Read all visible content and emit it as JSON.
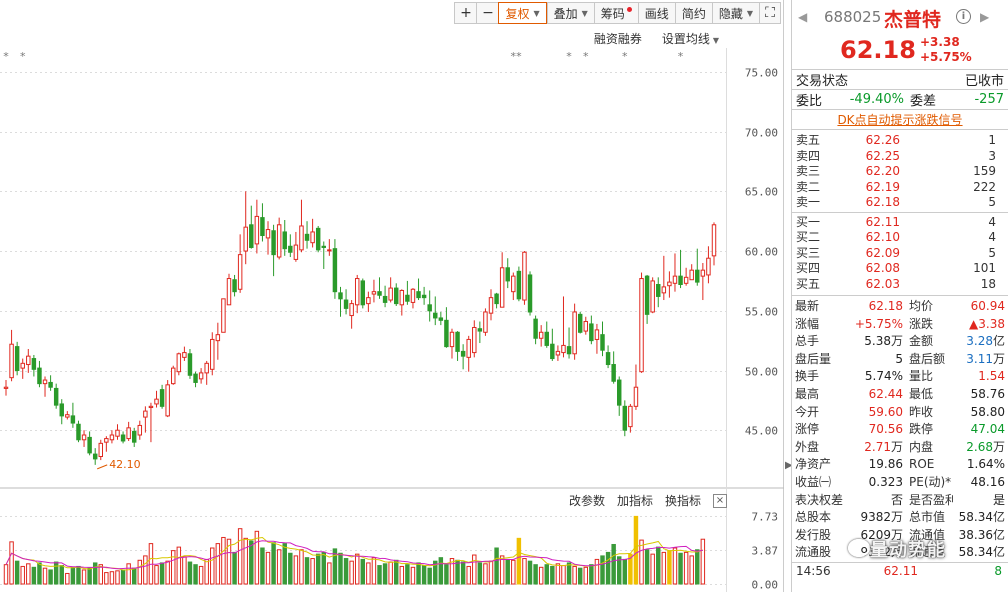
{
  "toolbar": {
    "plus": "+",
    "minus": "−",
    "fuquan": "复权",
    "diejia": "叠加",
    "chouma": "筹码",
    "huaxian": "画线",
    "jianyue": "简约",
    "yincang": "隐藏",
    "expand": "⛶"
  },
  "sub_toolbar": {
    "margin": "融资融券",
    "ma_settings": "设置均线"
  },
  "vol_toolbar": {
    "change_params": "改参数",
    "add_indicator": "加指标",
    "switch_indicator": "换指标",
    "close": "×"
  },
  "chart_data": {
    "type": "candlestick",
    "price_axis_labels": [
      "75.00",
      "70.00",
      "65.00",
      "60.00",
      "55.00",
      "50.00",
      "45.00"
    ],
    "price_ticks": [
      75,
      70,
      65,
      60,
      55,
      50,
      45
    ],
    "price_range": [
      41,
      77
    ],
    "volume_axis_labels": [
      "7.73",
      "3.87",
      "0.00"
    ],
    "volume_ticks": [
      7.73,
      3.87,
      0
    ],
    "volume_max": 8.2,
    "low_annotation": "42.10",
    "low_annotation_value": 42.1,
    "low_index": 16,
    "colors": {
      "up": "#e0281f",
      "down": "#2a9a2a",
      "vol_up": "#e0281f",
      "vol_down": "#3a9a3a",
      "vol_highlight": "#f0c000",
      "ma1": "#d020c0",
      "ma2": "#d8c800"
    },
    "candles": [
      [
        48.5,
        49.2,
        47.9,
        48.6
      ],
      [
        49.4,
        53.4,
        49.1,
        52.2
      ],
      [
        52.0,
        52.4,
        49.6,
        50.0
      ],
      [
        50.2,
        51.0,
        49.3,
        50.6
      ],
      [
        50.5,
        51.8,
        49.8,
        51.2
      ],
      [
        51.0,
        51.3,
        49.5,
        50.1
      ],
      [
        50.2,
        50.8,
        48.6,
        48.9
      ],
      [
        48.9,
        49.5,
        47.8,
        49.2
      ],
      [
        49.0,
        49.6,
        48.3,
        48.6
      ],
      [
        48.5,
        48.9,
        46.8,
        47.1
      ],
      [
        47.2,
        47.6,
        45.5,
        46.2
      ],
      [
        46.1,
        46.6,
        45.9,
        46.3
      ],
      [
        46.2,
        47.3,
        45.2,
        45.6
      ],
      [
        45.5,
        45.8,
        44.0,
        44.2
      ],
      [
        44.2,
        45.0,
        43.6,
        44.6
      ],
      [
        44.4,
        44.9,
        42.9,
        43.1
      ],
      [
        43.0,
        43.5,
        42.1,
        42.6
      ],
      [
        42.8,
        44.2,
        42.5,
        43.9
      ],
      [
        44.0,
        44.5,
        43.2,
        44.3
      ],
      [
        44.2,
        45.0,
        43.9,
        44.6
      ],
      [
        44.5,
        45.5,
        44.2,
        45.0
      ],
      [
        44.6,
        44.9,
        43.9,
        44.1
      ],
      [
        44.3,
        45.7,
        44.1,
        45.2
      ],
      [
        44.9,
        45.2,
        43.6,
        44.0
      ],
      [
        44.6,
        45.8,
        44.2,
        45.4
      ],
      [
        46.1,
        47.0,
        44.8,
        46.6
      ],
      [
        46.9,
        47.3,
        44.0,
        47.0
      ],
      [
        47.2,
        48.3,
        46.9,
        47.6
      ],
      [
        48.4,
        48.8,
        46.8,
        47.0
      ],
      [
        46.2,
        49.2,
        46.1,
        48.8
      ],
      [
        48.9,
        50.4,
        48.8,
        50.2
      ],
      [
        49.9,
        51.5,
        49.6,
        51.4
      ],
      [
        51.1,
        52.0,
        50.8,
        51.5
      ],
      [
        51.4,
        51.8,
        49.3,
        49.6
      ],
      [
        49.7,
        49.9,
        48.6,
        49.0
      ],
      [
        49.3,
        50.2,
        48.9,
        49.8
      ],
      [
        49.8,
        50.8,
        48.8,
        50.6
      ],
      [
        50.1,
        53.2,
        49.6,
        52.6
      ],
      [
        52.5,
        54.0,
        50.9,
        53.0
      ],
      [
        53.2,
        56.0,
        53.2,
        56.0
      ],
      [
        55.5,
        58.1,
        55.5,
        57.7
      ],
      [
        57.6,
        58.0,
        56.2,
        56.6
      ],
      [
        56.8,
        61.4,
        56.5,
        59.7
      ],
      [
        60.0,
        65.0,
        58.9,
        62.0
      ],
      [
        62.2,
        63.8,
        60.2,
        60.3
      ],
      [
        60.6,
        64.3,
        59.8,
        62.9
      ],
      [
        62.8,
        64.0,
        60.8,
        61.3
      ],
      [
        61.1,
        62.5,
        59.7,
        61.8
      ],
      [
        61.7,
        62.2,
        57.9,
        59.7
      ],
      [
        59.5,
        62.8,
        59.3,
        62.2
      ],
      [
        61.6,
        62.6,
        59.6,
        60.2
      ],
      [
        60.4,
        61.4,
        59.5,
        59.9
      ],
      [
        59.3,
        61.6,
        59.1,
        60.5
      ],
      [
        60.1,
        64.3,
        59.9,
        62.1
      ],
      [
        61.4,
        62.5,
        60.2,
        60.9
      ],
      [
        60.7,
        62.7,
        60.3,
        61.6
      ],
      [
        61.9,
        62.1,
        59.9,
        60.1
      ],
      [
        60.4,
        60.8,
        58.5,
        60.3
      ],
      [
        60.1,
        61.0,
        59.6,
        60.1
      ],
      [
        60.2,
        61.0,
        56.0,
        56.6
      ],
      [
        56.5,
        57.0,
        54.5,
        56.0
      ],
      [
        55.9,
        56.8,
        54.7,
        55.2
      ],
      [
        54.6,
        55.9,
        53.5,
        55.6
      ],
      [
        55.5,
        58.0,
        54.8,
        57.7
      ],
      [
        57.5,
        57.7,
        55.2,
        55.5
      ],
      [
        55.6,
        56.6,
        54.9,
        56.1
      ],
      [
        56.4,
        57.6,
        55.7,
        56.6
      ],
      [
        56.6,
        57.8,
        56.0,
        56.3
      ],
      [
        56.2,
        57.1,
        55.3,
        55.7
      ],
      [
        55.9,
        57.8,
        55.7,
        56.9
      ],
      [
        56.9,
        57.3,
        55.4,
        55.6
      ],
      [
        55.5,
        56.8,
        54.6,
        56.7
      ],
      [
        56.3,
        57.5,
        55.5,
        55.8
      ],
      [
        55.7,
        56.9,
        55.2,
        56.8
      ],
      [
        56.6,
        57.7,
        55.9,
        56.1
      ],
      [
        56.3,
        57.0,
        55.5,
        56.1
      ],
      [
        55.5,
        56.7,
        54.1,
        55.0
      ],
      [
        54.8,
        56.2,
        53.8,
        54.4
      ],
      [
        54.4,
        54.9,
        53.8,
        54.2
      ],
      [
        54.2,
        55.3,
        51.9,
        52.0
      ],
      [
        52.0,
        53.5,
        51.0,
        53.2
      ],
      [
        53.2,
        53.3,
        50.8,
        51.6
      ],
      [
        51.6,
        52.2,
        50.1,
        51.2
      ],
      [
        51.1,
        52.9,
        49.9,
        52.6
      ],
      [
        51.5,
        54.2,
        51.1,
        53.6
      ],
      [
        53.5,
        54.1,
        52.3,
        53.3
      ],
      [
        53.2,
        55.2,
        52.9,
        54.9
      ],
      [
        54.8,
        56.8,
        54.2,
        56.1
      ],
      [
        56.4,
        56.5,
        55.2,
        55.6
      ],
      [
        55.3,
        59.9,
        55.3,
        58.6
      ],
      [
        58.6,
        59.4,
        56.9,
        57.5
      ],
      [
        56.6,
        58.2,
        55.9,
        57.9
      ],
      [
        58.3,
        58.7,
        55.8,
        56.0
      ],
      [
        55.9,
        60.0,
        55.5,
        59.9
      ],
      [
        58.0,
        58.3,
        54.6,
        54.9
      ],
      [
        54.3,
        54.6,
        52.2,
        52.7
      ],
      [
        52.7,
        53.8,
        52.0,
        53.2
      ],
      [
        53.2,
        54.1,
        51.9,
        52.1
      ],
      [
        52.2,
        53.5,
        50.8,
        51.0
      ],
      [
        51.3,
        52.1,
        50.8,
        51.6
      ],
      [
        51.5,
        56.2,
        51.1,
        52.1
      ],
      [
        52.0,
        53.6,
        51.0,
        51.4
      ],
      [
        51.4,
        55.6,
        50.9,
        54.9
      ],
      [
        54.7,
        54.9,
        53.1,
        53.2
      ],
      [
        53.3,
        54.5,
        53.0,
        54.1
      ],
      [
        53.9,
        54.6,
        52.2,
        52.5
      ],
      [
        52.6,
        53.9,
        51.4,
        53.4
      ],
      [
        53.0,
        54.1,
        51.2,
        51.7
      ],
      [
        51.5,
        52.1,
        50.2,
        50.5
      ],
      [
        50.5,
        51.6,
        48.9,
        49.1
      ],
      [
        49.2,
        49.5,
        46.2,
        47.1
      ],
      [
        47.0,
        47.5,
        44.5,
        45.0
      ],
      [
        45.3,
        47.2,
        44.8,
        47.0
      ],
      [
        47.0,
        50.5,
        46.7,
        48.6
      ],
      [
        49.9,
        58.2,
        49.8,
        57.7
      ],
      [
        57.9,
        58.0,
        53.9,
        54.7
      ],
      [
        54.9,
        57.8,
        54.8,
        57.5
      ],
      [
        57.2,
        57.8,
        55.3,
        56.2
      ],
      [
        56.5,
        59.6,
        55.9,
        57.0
      ],
      [
        57.1,
        58.3,
        56.1,
        57.4
      ],
      [
        57.3,
        59.8,
        56.6,
        57.9
      ],
      [
        57.9,
        60.1,
        56.9,
        57.2
      ],
      [
        57.3,
        58.6,
        57.1,
        57.8
      ],
      [
        57.6,
        58.9,
        57.6,
        58.4
      ],
      [
        58.4,
        60.2,
        57.1,
        57.4
      ],
      [
        57.9,
        59.0,
        55.9,
        58.4
      ],
      [
        58.0,
        60.4,
        57.3,
        59.4
      ],
      [
        59.6,
        62.4,
        58.8,
        62.2
      ]
    ],
    "volumes": [
      2.2,
      4.8,
      2.6,
      2.0,
      2.3,
      1.9,
      2.4,
      1.8,
      1.6,
      2.5,
      2.1,
      1.2,
      1.9,
      2.0,
      1.6,
      1.8,
      2.4,
      2.2,
      1.3,
      1.4,
      1.5,
      1.6,
      2.3,
      1.8,
      2.7,
      3.2,
      4.6,
      2.1,
      2.4,
      2.6,
      3.8,
      4.2,
      3.1,
      2.5,
      2.2,
      2.0,
      2.8,
      4.1,
      4.6,
      5.3,
      5.1,
      3.6,
      6.3,
      5.2,
      4.9,
      6.0,
      4.1,
      3.6,
      4.7,
      3.9,
      4.6,
      3.5,
      3.2,
      3.9,
      3.0,
      2.9,
      3.4,
      3.6,
      2.4,
      4.0,
      3.5,
      2.9,
      2.6,
      3.4,
      2.8,
      2.4,
      3.0,
      2.1,
      2.3,
      2.5,
      2.7,
      2.0,
      2.2,
      1.9,
      2.4,
      2.1,
      1.8,
      2.6,
      3.0,
      2.2,
      2.9,
      2.7,
      2.5,
      2.0,
      3.3,
      2.4,
      2.3,
      2.6,
      4.1,
      3.2,
      2.8,
      2.7,
      5.2,
      2.9,
      2.6,
      2.2,
      1.9,
      2.2,
      2.0,
      2.3,
      2.1,
      2.4,
      2.0,
      1.8,
      1.9,
      2.2,
      2.8,
      3.2,
      3.6,
      4.5,
      3.1,
      2.8,
      3.4,
      7.7,
      5.0,
      3.9,
      3.4,
      4.2,
      3.6,
      3.8,
      4.1,
      3.5,
      3.6,
      3.2,
      3.9,
      5.1
    ],
    "highlight_volume_idx": [
      92,
      113
    ],
    "annotation_marker": "*"
  },
  "quote": {
    "code": "688025",
    "name": "杰普特",
    "price": "62.18",
    "change": "+3.38",
    "change_pct": "+5.75%",
    "prev_icon": "◀",
    "next_icon": "▶",
    "info_icon": "i"
  },
  "status": {
    "label": "交易状态",
    "value": "已收市"
  },
  "weibi": {
    "label1": "委比",
    "value1": "-49.40%",
    "label2": "委差",
    "value2": "-257"
  },
  "dk_link": "DK点自动提示涨跌信号",
  "orderbook": {
    "asks": [
      {
        "label": "卖五",
        "price": "62.26",
        "vol": "1"
      },
      {
        "label": "卖四",
        "price": "62.25",
        "vol": "3"
      },
      {
        "label": "卖三",
        "price": "62.20",
        "vol": "159"
      },
      {
        "label": "卖二",
        "price": "62.19",
        "vol": "222"
      },
      {
        "label": "卖一",
        "price": "62.18",
        "vol": "5"
      }
    ],
    "bids": [
      {
        "label": "买一",
        "price": "62.11",
        "vol": "4"
      },
      {
        "label": "买二",
        "price": "62.10",
        "vol": "4"
      },
      {
        "label": "买三",
        "price": "62.09",
        "vol": "5"
      },
      {
        "label": "买四",
        "price": "62.08",
        "vol": "101"
      },
      {
        "label": "买五",
        "price": "62.03",
        "vol": "18"
      }
    ]
  },
  "stats": [
    {
      "k1": "最新",
      "v1": "62.18",
      "c1": "red",
      "u1": "",
      "k2": "均价",
      "v2": "60.94",
      "c2": "red",
      "u2": ""
    },
    {
      "k1": "涨幅",
      "v1": "+5.75%",
      "c1": "red",
      "u1": "",
      "k2": "涨跌",
      "v2": "▲3.38",
      "c2": "red",
      "u2": ""
    },
    {
      "k1": "总手",
      "v1": "5.38",
      "c1": "",
      "u1": "万",
      "k2": "金额",
      "v2": "3.28",
      "c2": "blue",
      "u2": "亿"
    },
    {
      "k1": "盘后量",
      "v1": "5",
      "c1": "",
      "u1": "",
      "k2": "盘后额",
      "v2": "3.11",
      "c2": "blue",
      "u2": "万"
    },
    {
      "k1": "换手",
      "v1": "5.74%",
      "c1": "",
      "u1": "",
      "k2": "量比",
      "v2": "1.54",
      "c2": "red",
      "u2": ""
    },
    {
      "k1": "最高",
      "v1": "62.44",
      "c1": "red",
      "u1": "",
      "k2": "最低",
      "v2": "58.76",
      "c2": "",
      "u2": ""
    },
    {
      "k1": "今开",
      "v1": "59.60",
      "c1": "red",
      "u1": "",
      "k2": "昨收",
      "v2": "58.80",
      "c2": "",
      "u2": ""
    },
    {
      "k1": "涨停",
      "v1": "70.56",
      "c1": "red",
      "u1": "",
      "k2": "跌停",
      "v2": "47.04",
      "c2": "green",
      "u2": ""
    },
    {
      "k1": "外盘",
      "v1": "2.71",
      "c1": "red",
      "u1": "万",
      "k2": "内盘",
      "v2": "2.68",
      "c2": "green",
      "u2": "万"
    },
    {
      "k1": "净资产",
      "v1": "19.86",
      "c1": "",
      "u1": "",
      "k2": "ROE",
      "v2": "1.64%",
      "c2": "",
      "u2": ""
    },
    {
      "k1": "收益㈠",
      "v1": "0.323",
      "c1": "",
      "u1": "",
      "k2": "PE(动)*",
      "v2": "48.16",
      "c2": "",
      "u2": ""
    },
    {
      "k1": "表决权差异",
      "v1": "否",
      "c1": "",
      "u1": "",
      "k2": "是否盈利",
      "v2": "是",
      "c2": "",
      "u2": ""
    },
    {
      "k1": "总股本",
      "v1": "9382",
      "c1": "",
      "u1": "万",
      "k2": "总市值",
      "v2": "58.34",
      "c2": "",
      "u2": "亿"
    },
    {
      "k1": "发行股",
      "v1": "6209",
      "c1": "",
      "u1": "万",
      "k2": "流通值",
      "v2": "38.36",
      "c2": "",
      "u2": "亿"
    },
    {
      "k1": "流通股",
      "v1": "9382",
      "c1": "",
      "u1": "万",
      "k2": "流通值",
      "v2": "58.34",
      "c2": "",
      "u2": "亿"
    }
  ],
  "trade_tick": {
    "time": "14:56",
    "price": "62.11",
    "vol": "8"
  },
  "watermark": "量动势能"
}
